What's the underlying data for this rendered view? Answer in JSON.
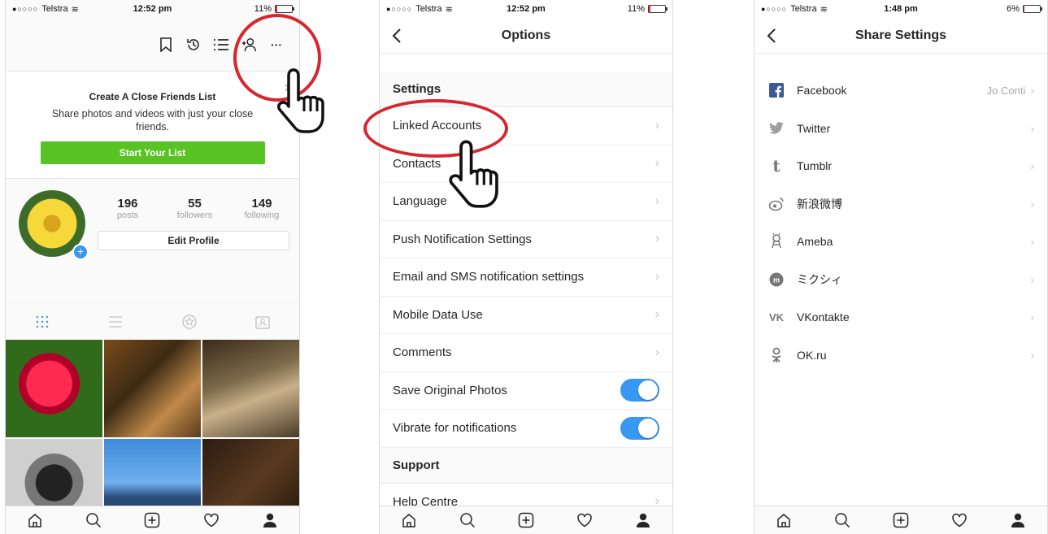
{
  "status": [
    {
      "carrier": "Telstra",
      "time": "12:52 pm",
      "battery": "11%",
      "battery_level": 0.11
    },
    {
      "carrier": "Telstra",
      "time": "12:52 pm",
      "battery": "11%",
      "battery_level": 0.11
    },
    {
      "carrier": "Telstra",
      "time": "1:48 pm",
      "battery": "6%",
      "battery_level": 0.06
    }
  ],
  "profile_screen": {
    "promo": {
      "title": "Create A Close Friends List",
      "body": "Share photos and videos with just your close friends.",
      "button": "Start Your List",
      "close": "×"
    },
    "stats": [
      {
        "value": "196",
        "label": "posts"
      },
      {
        "value": "55",
        "label": "followers"
      },
      {
        "value": "149",
        "label": "following"
      }
    ],
    "edit_profile": "Edit Profile",
    "more_label": "···"
  },
  "options_screen": {
    "title": "Options",
    "sections": [
      {
        "title": "Settings"
      },
      {
        "title": "Support"
      }
    ],
    "items": [
      {
        "label": "Linked Accounts"
      },
      {
        "label": "Contacts"
      },
      {
        "label": "Language"
      },
      {
        "label": "Push Notification Settings"
      },
      {
        "label": "Email and SMS notification settings"
      },
      {
        "label": "Mobile Data Use"
      },
      {
        "label": "Comments"
      },
      {
        "label": "Save Original Photos",
        "toggle": true
      },
      {
        "label": "Vibrate for notifications",
        "toggle": true
      },
      {
        "label": "Help Centre"
      }
    ]
  },
  "share_screen": {
    "title": "Share Settings",
    "items": [
      {
        "label": "Facebook",
        "value": "Jo Conti",
        "icon": "facebook-icon"
      },
      {
        "label": "Twitter",
        "icon": "twitter-icon"
      },
      {
        "label": "Tumblr",
        "icon": "tumblr-icon"
      },
      {
        "label": "新浪微博",
        "icon": "weibo-icon"
      },
      {
        "label": "Ameba",
        "icon": "ameba-icon"
      },
      {
        "label": "ミクシィ",
        "icon": "mixi-icon"
      },
      {
        "label": "VKontakte",
        "icon": "vk-icon"
      },
      {
        "label": "OK.ru",
        "icon": "okru-icon"
      }
    ]
  },
  "colors": {
    "accent": "#3897f0",
    "green": "#58c322",
    "highlight_ring": "#d7262e",
    "facebook": "#3b5998"
  }
}
